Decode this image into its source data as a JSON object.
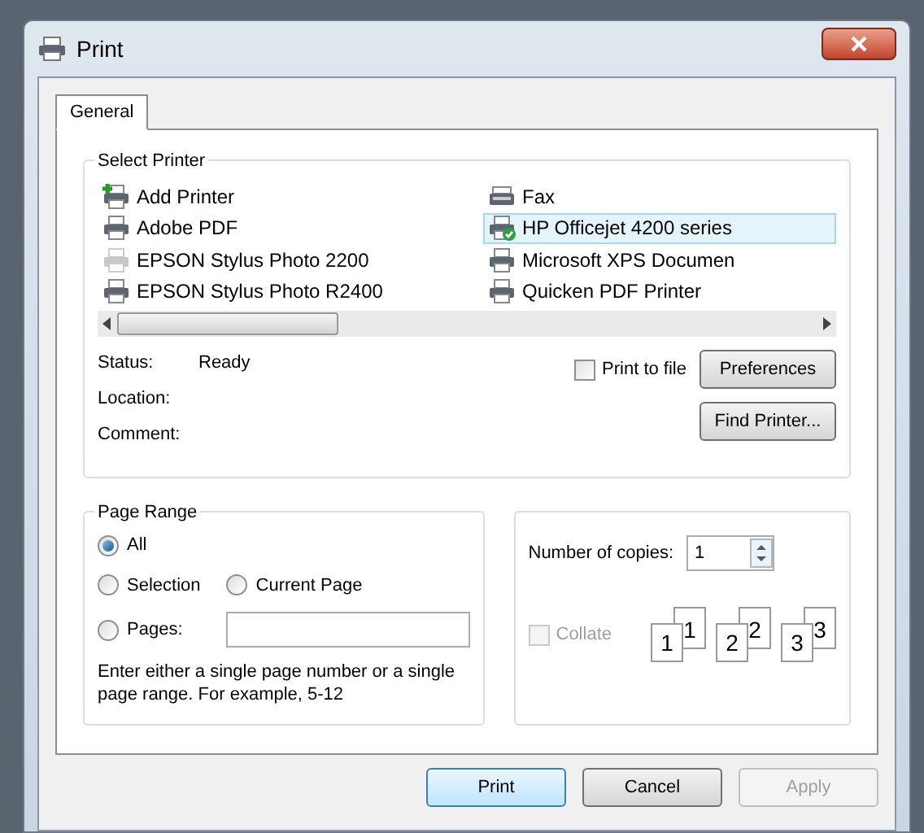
{
  "window": {
    "title": "Print"
  },
  "tabs": [
    {
      "label": "General",
      "selected": true
    }
  ],
  "select_printer": {
    "title": "Select Printer",
    "printers": [
      {
        "name": "Add Printer",
        "kind": "add",
        "selected": false,
        "offline": false
      },
      {
        "name": "Adobe PDF",
        "kind": "printer",
        "selected": false,
        "offline": false
      },
      {
        "name": "EPSON Stylus Photo 2200",
        "kind": "printer",
        "selected": false,
        "offline": true
      },
      {
        "name": "EPSON Stylus Photo R2400",
        "kind": "printer",
        "selected": false,
        "offline": false
      },
      {
        "name": "Fax",
        "kind": "fax",
        "selected": false,
        "offline": false
      },
      {
        "name": "HP Officejet 4200 series",
        "kind": "default",
        "selected": true,
        "offline": false
      },
      {
        "name": "Microsoft XPS Documen",
        "kind": "printer",
        "selected": false,
        "offline": false
      },
      {
        "name": "Quicken PDF Printer",
        "kind": "printer",
        "selected": false,
        "offline": false
      }
    ],
    "info": [
      {
        "label": "Status:",
        "value": "Ready"
      },
      {
        "label": "Location:"
      },
      {
        "label": "Comment:"
      }
    ],
    "print_to_file": {
      "label": "Print to file",
      "checked": false
    },
    "buttons": [
      "Preferences",
      "Find Printer..."
    ]
  },
  "page_range": {
    "title": "Page Range",
    "options": [
      {
        "label": "All",
        "selected": true
      },
      {
        "label": "Selection",
        "selected": false
      },
      {
        "label": "Current Page",
        "selected": false
      },
      {
        "label": "Pages:",
        "selected": false
      }
    ],
    "hint": "Enter either a single page number or a single page range.  For example, 5-12"
  },
  "copies": {
    "label": "Number of copies:",
    "value": "1",
    "collate": {
      "label": "Collate",
      "checked": false,
      "disabled": true
    },
    "sets": [
      [
        "1",
        "1"
      ],
      [
        "2",
        "2"
      ],
      [
        "3",
        "3"
      ]
    ]
  },
  "buttons": [
    {
      "label": "Print",
      "default": true,
      "disabled": false
    },
    {
      "label": "Cancel",
      "default": false,
      "disabled": false
    },
    {
      "label": "Apply",
      "default": false,
      "disabled": true
    }
  ]
}
